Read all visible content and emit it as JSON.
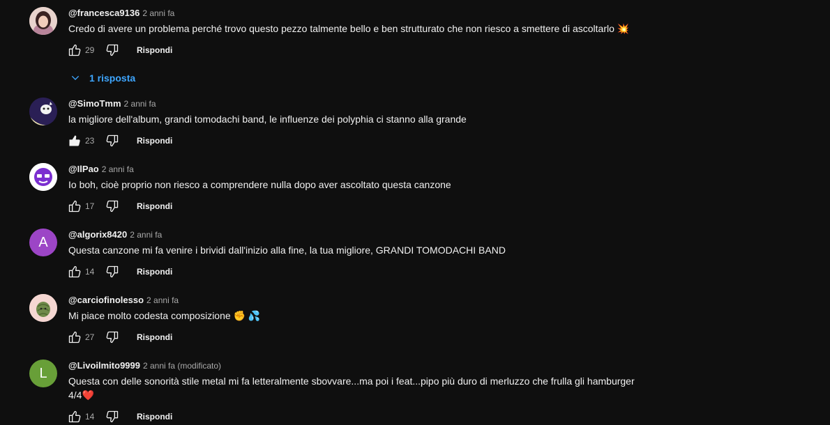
{
  "actions": {
    "reply_label": "Rispondi"
  },
  "comments": [
    {
      "author": "@francesca9136",
      "time": "2 anni fa",
      "likes": "29",
      "text": "Credo di avere un problema perché trovo questo pezzo talmente bello e ben strutturato che non riesco a smettere di ascoltarlo",
      "emoji": "💥",
      "liked": false,
      "avatar_icon": "portrait-avatar"
    },
    {
      "author": "@SimoTmm",
      "time": "2 anni fa",
      "likes": "23",
      "text": "la migliore dell'album, grandi tomodachi band, le influenze dei polyphia ci stanno alla grande",
      "liked": true,
      "avatar_icon": "cartoon-avatar"
    },
    {
      "author": "@IlPao",
      "time": "2 anni fa",
      "likes": "17",
      "text": "Io boh, cioè proprio non riesco a comprendere nulla dopo aver ascoltato questa canzone",
      "liked": false,
      "avatar_icon": "purple-face-avatar"
    },
    {
      "author": "@algorix8420",
      "time": "2 anni fa",
      "likes": "14",
      "text": "Questa canzone mi fa venire i brividi dall'inizio alla fine, la tua migliore, GRANDI TOMODACHI BAND",
      "liked": false,
      "avatar_letter": "A",
      "avatar_color": "#9c45c6"
    },
    {
      "author": "@carciofinolesso",
      "time": "2 anni fa",
      "likes": "27",
      "text": "Mi piace molto codesta composizione",
      "emoji": "✊ 💦",
      "liked": false,
      "avatar_icon": "artichoke-avatar"
    },
    {
      "author": "@Livoilmito9999",
      "time": "2 anni fa (modificato)",
      "likes": "14",
      "text": "Questa con delle sonorità stile metal mi fa letteralmente sbovvare...ma poi i feat...pipo più duro di merluzzo che frulla gli hamburger",
      "text2": "4/4",
      "emoji": "❤️",
      "liked": false,
      "avatar_letter": "L",
      "avatar_color": "#689f38"
    }
  ],
  "replies_toggle": {
    "label": "1 risposta"
  }
}
